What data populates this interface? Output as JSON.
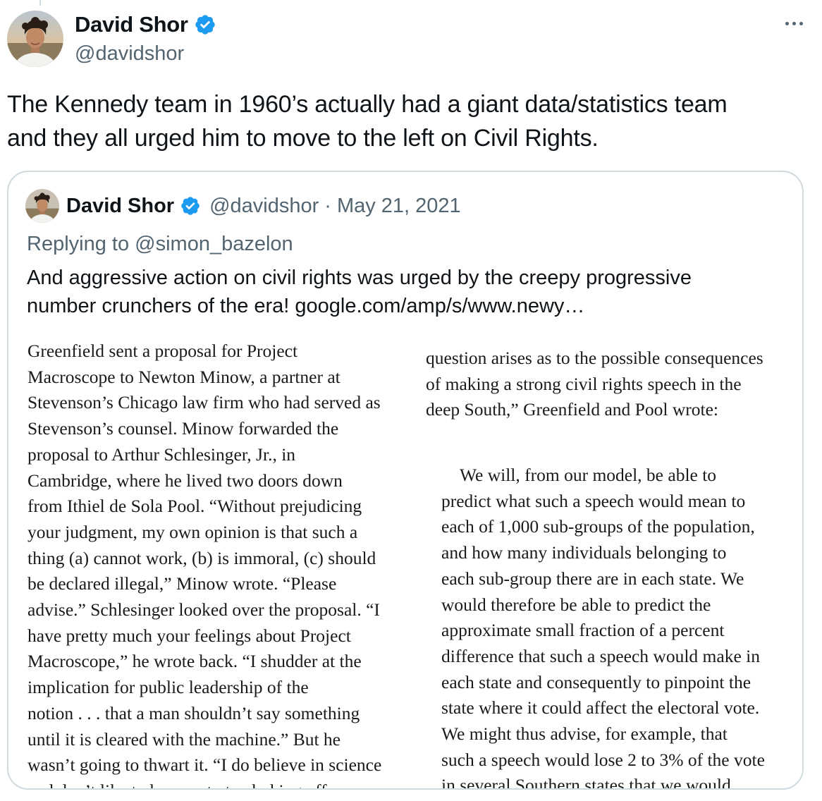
{
  "tweet": {
    "author_name": "David Shor",
    "author_handle": "@davidshor",
    "text_lines": [
      "The Kennedy team in 1960’s actually had a giant data/statistics team",
      "and they all urged him to move to the left on Civil Rights."
    ]
  },
  "quote": {
    "author_name": "David Shor",
    "author_handle": "@davidshor",
    "separator": "·",
    "date": "May 21, 2021",
    "replying_prefix": "Replying to ",
    "replying_to": "@simon_bazelon",
    "text_line_1": "And aggressive action on civil rights was urged by the creepy progressive",
    "text_line_2_prefix": "number crunchers of the era! ",
    "link": "google.com/amp/s/www.newy…",
    "book_image": {
      "left_column": [
        "Greenfield sent a proposal for Project",
        "Macroscope to Newton Minow, a partner at",
        "Stevenson’s Chicago law firm who had served as",
        "Stevenson’s counsel. Minow forwarded the",
        "proposal to Arthur Schlesinger, Jr., in",
        "Cambridge, where he lived two doors down",
        "from Ithiel de Sola Pool. “Without prejudicing",
        "your judgment, my own opinion is that such a",
        "thing (a) cannot work, (b) is immoral, (c) should",
        "be declared illegal,” Minow wrote. “Please",
        "advise.” Schlesinger looked over the proposal. “I",
        "have pretty much your feelings about Project",
        "Macroscope,” he wrote back. “I shudder at the",
        "implication for public leadership of the",
        "notion . . . that a man shouldn’t say something",
        "until it is cleared with the machine.” But he",
        "wasn’t going to thwart it. “I do believe in science",
        "and don’t like to be a party to choking off new"
      ],
      "right_column": [
        "question arises as to the possible consequences",
        "of making a strong civil rights speech in the",
        "deep South,” Greenfield and Pool wrote:"
      ],
      "block_quote": [
        "We will, from our model, be able to",
        "predict what such a speech would mean to",
        "each of 1,000 sub-groups of the population,",
        "and how many individuals belonging to",
        "each sub-group there are in each state. We",
        "would therefore be able to predict the",
        "approximate small fraction of a percent",
        "difference that such a speech would make in",
        "each state and consequently to pinpoint the",
        "state where it could affect the electoral vote.",
        "We might thus advise, for example, that",
        "such a speech would lose 2 to 3% of the vote",
        "in several Southern states that we would"
      ]
    }
  },
  "icons": {
    "verified": "verified-badge-icon",
    "more": "more-options-icon"
  },
  "colors": {
    "verified": "#1d9bf0",
    "secondary_text": "#536471",
    "border": "#cfd9de"
  }
}
